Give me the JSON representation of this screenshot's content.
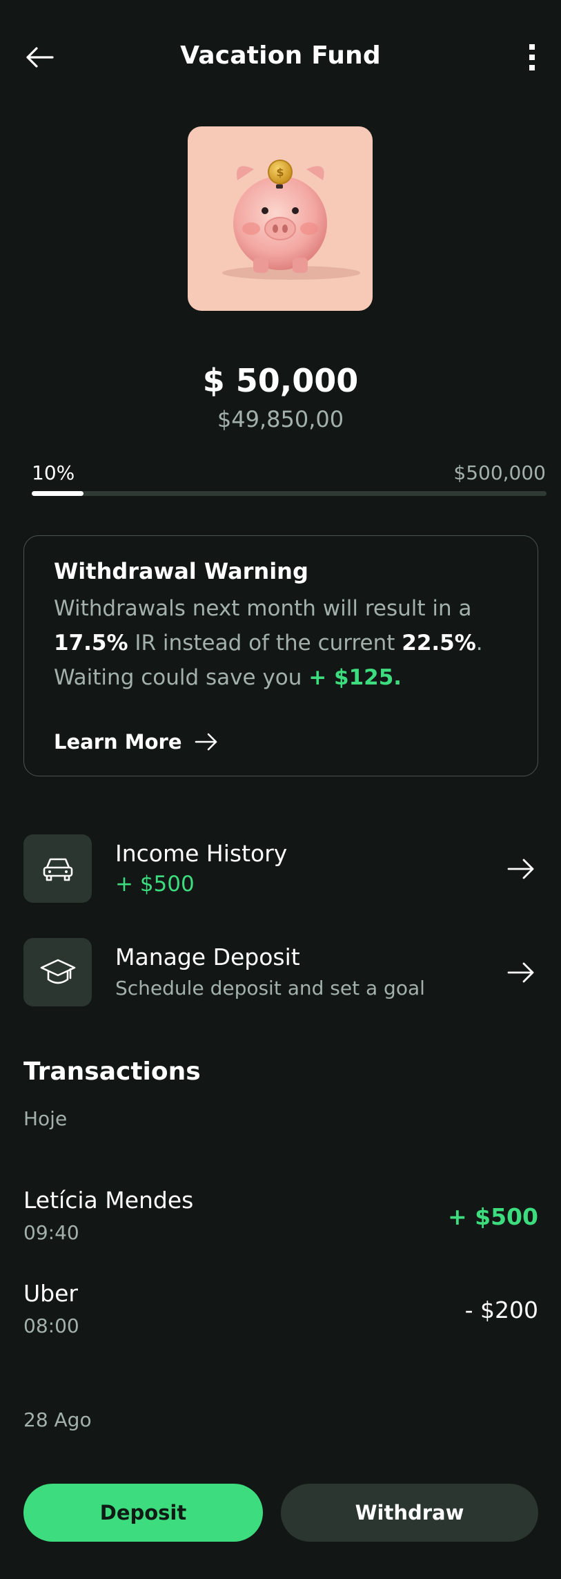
{
  "header": {
    "title": "Vacation Fund",
    "back_icon": "arrow-left-icon",
    "more_icon": "more-vertical-icon"
  },
  "hero": {
    "image": "piggy-bank-with-coin"
  },
  "balance": {
    "amount": "$ 50,000",
    "secondary": "$49,850,00"
  },
  "progress": {
    "percent_label": "10%",
    "goal_label": "$500,000",
    "fraction": 0.1
  },
  "warning": {
    "title": "Withdrawal Warning",
    "text_1": "Withdrawals next month will result in a ",
    "rate_new": "17.5%",
    "text_2": " IR instead of the current ",
    "rate_current": "22.5%",
    "text_3": ".",
    "text_4": "Waiting could save you ",
    "savings": "+ $125.",
    "learn_more": "Learn More"
  },
  "actions": [
    {
      "title": "Income History",
      "subtitle": "+ $500",
      "icon": "car-icon"
    },
    {
      "title": "Manage Deposit",
      "subtitle": "Schedule deposit and set a goal",
      "icon": "graduation-cap-icon"
    }
  ],
  "transactions": {
    "title": "Transactions",
    "groups": [
      {
        "label": "Hoje",
        "items": [
          {
            "name": "Letícia Mendes",
            "time": "09:40",
            "amount": "+ $500"
          },
          {
            "name": "Uber",
            "time": "08:00",
            "amount": "- $200"
          }
        ]
      },
      {
        "label": "28 Ago",
        "items": []
      }
    ]
  },
  "buttons": {
    "deposit": "Deposit",
    "withdraw": "Withdraw"
  },
  "colors": {
    "background": "#121715",
    "accent_green": "#3ddc7e",
    "surface": "#2b3630",
    "muted_text": "#a3b0ab",
    "hero_bg": "#f7c9b7"
  }
}
